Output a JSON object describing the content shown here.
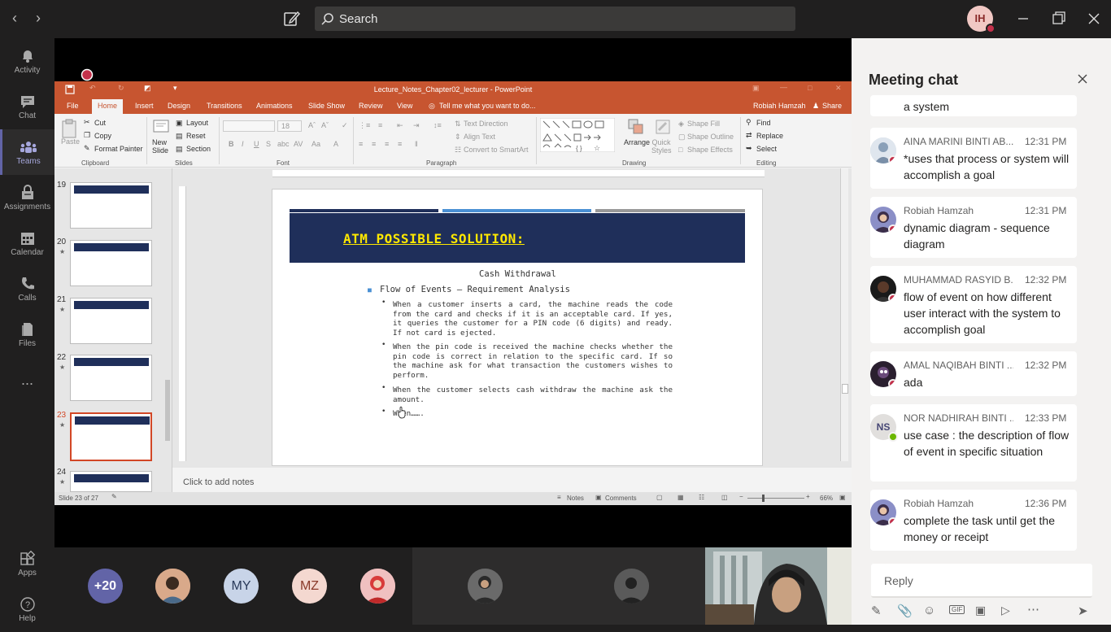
{
  "topbar": {
    "search_placeholder": "Search",
    "user_initials": "IH"
  },
  "rail": {
    "items": [
      {
        "label": "Activity",
        "icon": "bell-icon"
      },
      {
        "label": "Chat",
        "icon": "chat-icon"
      },
      {
        "label": "Teams",
        "icon": "teams-icon"
      },
      {
        "label": "Assignments",
        "icon": "assignments-icon"
      },
      {
        "label": "Calendar",
        "icon": "calendar-icon"
      },
      {
        "label": "Calls",
        "icon": "phone-icon"
      },
      {
        "label": "Files",
        "icon": "files-icon"
      }
    ],
    "more": "...",
    "apps": "Apps",
    "help": "Help"
  },
  "ppt": {
    "title": "Lecture_Notes_Chapter02_lecturer - PowerPoint",
    "tabs": [
      "File",
      "Home",
      "Insert",
      "Design",
      "Transitions",
      "Animations",
      "Slide Show",
      "Review",
      "View"
    ],
    "tell_me": "Tell me what you want to do...",
    "user": "Robiah Hamzah",
    "share": "Share",
    "ribbon": {
      "paste": "Paste",
      "cut": "Cut",
      "copy": "Copy",
      "format_painter": "Format Painter",
      "clipboard": "Clipboard",
      "new_slide": "New Slide",
      "layout": "Layout",
      "reset": "Reset",
      "section": "Section",
      "slides": "Slides",
      "font_size": "18",
      "font": "Font",
      "text_direction": "Text Direction",
      "align_text": "Align Text",
      "convert_smartart": "Convert to SmartArt",
      "paragraph": "Paragraph",
      "arrange": "Arrange",
      "quick_styles": "Quick Styles",
      "shape_fill": "Shape Fill",
      "shape_outline": "Shape Outline",
      "shape_effects": "Shape Effects",
      "drawing": "Drawing",
      "find": "Find",
      "replace": "Replace",
      "select": "Select",
      "editing": "Editing"
    },
    "thumbnails": [
      {
        "num": "19",
        "star": ""
      },
      {
        "num": "20",
        "star": "★"
      },
      {
        "num": "21",
        "star": "★"
      },
      {
        "num": "22",
        "star": "★"
      },
      {
        "num": "23",
        "star": "★"
      },
      {
        "num": "24",
        "star": "★"
      }
    ],
    "slide": {
      "title": "ATM POSSIBLE SOLUTION:",
      "subtitle": "Cash Withdrawal",
      "bullet_main": "Flow of Events – Requirement Analysis",
      "bullets": [
        "When a customer inserts a card, the machine reads the code from the card and checks if it is an acceptable card. If yes, it queries the customer for a PIN code (6 digits) and ready. If not card is ejected.",
        "When the pin code is received the machine checks whether the pin code is correct in relation to the specific card. If so the machine ask for what transaction the customers wishes to perform.",
        "When the customer selects cash withdraw the machine ask the amount.",
        "When……."
      ]
    },
    "notes_placeholder": "Click to add notes",
    "status": {
      "slide_of": "Slide 23 of 27",
      "notes": "Notes",
      "comments": "Comments",
      "zoom": "66%"
    }
  },
  "chat": {
    "title": "Meeting chat",
    "partial_text": "a system",
    "messages": [
      {
        "name": "AINA MARINI BINTI AB...",
        "time": "12:31 PM",
        "text": "*uses that process or system will accomplish a goal",
        "status": "busy"
      },
      {
        "name": "Robiah Hamzah",
        "time": "12:31 PM",
        "text": "dynamic diagram - sequence diagram",
        "status": "busy"
      },
      {
        "name": "MUHAMMAD RASYID B...",
        "time": "12:32 PM",
        "text": "flow of event on how different user interact with the system to accomplish goal",
        "status": "busy"
      },
      {
        "name": "AMAL NAQIBAH BINTI ...",
        "time": "12:32 PM",
        "text": "ada",
        "status": "busy"
      },
      {
        "name": "NOR NADHIRAH BINTI ...",
        "time": "12:33 PM",
        "text": "use case : the description of flow of event in specific situation",
        "status": "available",
        "initials": "NS"
      },
      {
        "name": "Robiah Hamzah",
        "time": "12:36 PM",
        "text": "complete the task  until get the money  or receipt",
        "status": "busy"
      }
    ],
    "reply_placeholder": "Reply"
  },
  "callbar": {
    "overflow_count": "+20",
    "participants": [
      "MY",
      "MZ"
    ]
  },
  "colors": {
    "ppt_accent": "#c75530",
    "teams_purple": "#6264a7",
    "slide_banner": "#1f2f5a",
    "slide_title": "#ffe800",
    "busy": "#c4314b",
    "available": "#6bb700"
  }
}
